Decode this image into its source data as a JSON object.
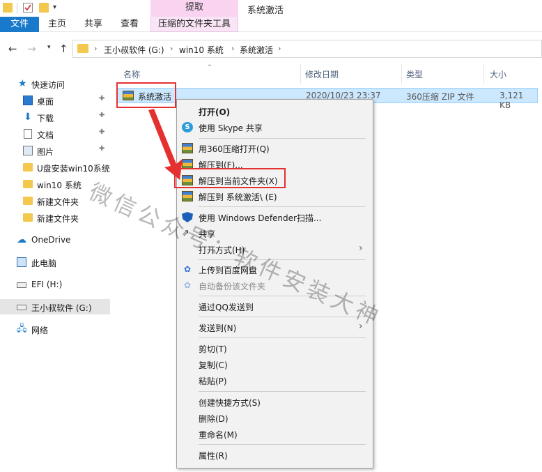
{
  "quick_access_toolbar": {
    "dropdown_glyph": "▾"
  },
  "ribbon": {
    "file_tab": "文件",
    "home_tab": "主页",
    "share_tab": "共享",
    "view_tab": "查看",
    "context_group": "提取",
    "tools_tab": "压缩的文件夹工具"
  },
  "window_title": "系统激活",
  "address_bar": {
    "crumbs": [
      "王小叔软件 (G:)",
      "win10 系统",
      "系统激活"
    ]
  },
  "columns": {
    "name": "名称",
    "modified": "修改日期",
    "type": "类型",
    "size": "大小"
  },
  "sidebar": {
    "quick_access": "快速访问",
    "items": [
      {
        "label": "桌面",
        "pinned": true
      },
      {
        "label": "下载",
        "pinned": true
      },
      {
        "label": "文档",
        "pinned": true
      },
      {
        "label": "图片",
        "pinned": true
      },
      {
        "label": "U盘安装win10系统",
        "pinned": false
      },
      {
        "label": "win10 系统",
        "pinned": false
      },
      {
        "label": "新建文件夹",
        "pinned": false
      },
      {
        "label": "新建文件夹",
        "pinned": false
      }
    ],
    "onedrive": "OneDrive",
    "this_pc": "此电脑",
    "efi": "EFI (H:)",
    "drive_g": "王小叔软件 (G:)",
    "network": "网络",
    "pin_glyph": "📌"
  },
  "file": {
    "name": "系统激活",
    "modified": "2020/10/23 23:37",
    "type": "360压缩 ZIP 文件",
    "size": "3,121 KB"
  },
  "context_menu": {
    "open": "打开(O)",
    "skype_share": "使用 Skype 共享",
    "open_360": "用360压缩打开(Q)",
    "extract_to": "解压到(F)...",
    "extract_here": "解压到当前文件夹(X)",
    "extract_to_folder": "解压到 系统激活\\ (E)",
    "defender_scan": "使用 Windows Defender扫描...",
    "share": "共享",
    "open_with": "打开方式(H)",
    "upload_baidu": "上传到百度网盘",
    "auto_backup": "自动备份该文件夹",
    "send_qq": "通过QQ发送到",
    "send_to": "发送到(N)",
    "cut": "剪切(T)",
    "copy": "复制(C)",
    "paste": "粘贴(P)",
    "create_shortcut": "创建快捷方式(S)",
    "delete": "删除(D)",
    "rename": "重命名(M)",
    "properties": "属性(R)",
    "submenu_glyph": "›"
  },
  "watermark": "微信公众号：软件安装大神",
  "colors": {
    "file_tab_bg": "#1979ca",
    "context_tab_bg": "#f9d3ef",
    "selection_bg": "#cce8ff",
    "highlight_red": "#e53030"
  }
}
